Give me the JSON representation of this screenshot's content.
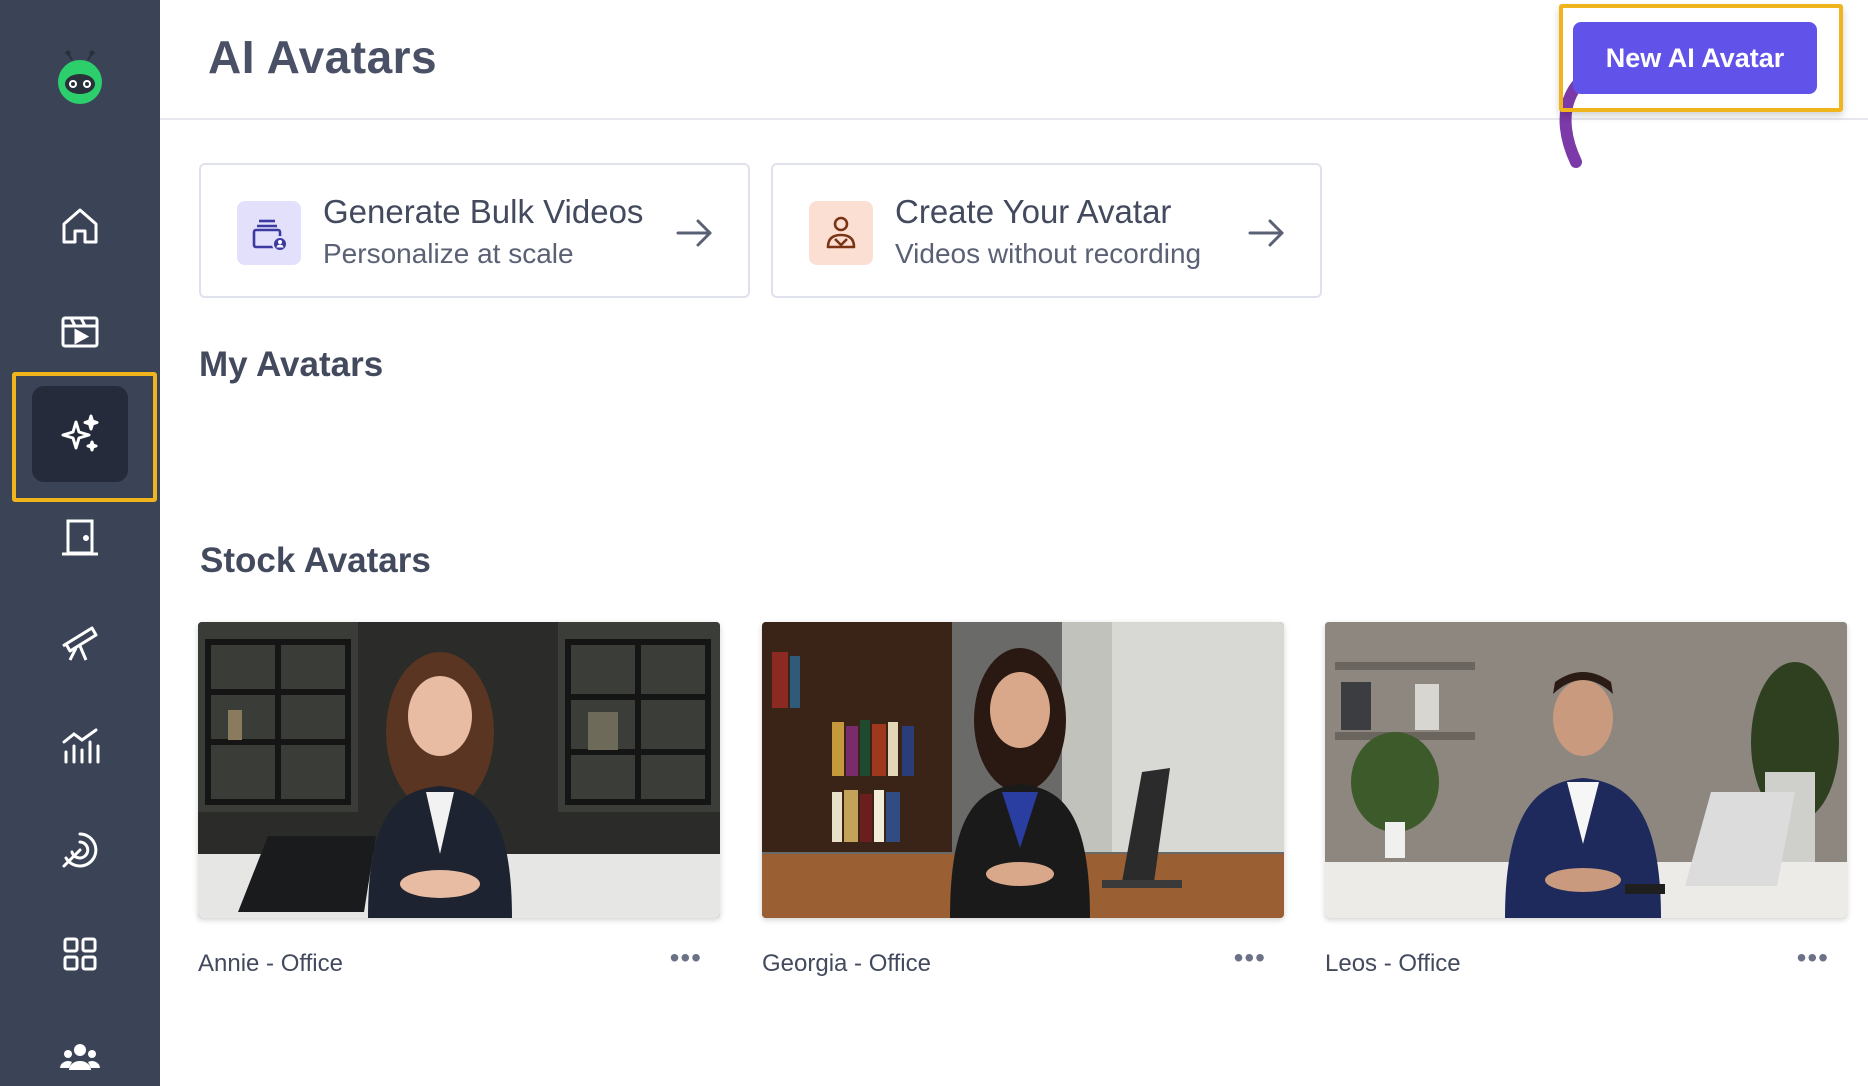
{
  "page": {
    "title": "AI Avatars"
  },
  "header": {
    "new_avatar_label": "New AI Avatar"
  },
  "sidebar": {
    "items": [
      {
        "icon": "home-icon"
      },
      {
        "icon": "video-clapper-icon"
      },
      {
        "icon": "sparkles-icon",
        "active": true
      },
      {
        "icon": "door-icon"
      },
      {
        "icon": "telescope-icon"
      },
      {
        "icon": "analytics-icon"
      },
      {
        "icon": "integrations-icon"
      },
      {
        "icon": "apps-grid-icon"
      },
      {
        "icon": "team-icon"
      }
    ]
  },
  "actions": [
    {
      "title": "Generate Bulk Videos",
      "subtitle": "Personalize at scale",
      "icon": "bulk-videos-icon"
    },
    {
      "title": "Create Your Avatar",
      "subtitle": "Videos without recording",
      "icon": "create-avatar-icon"
    }
  ],
  "sections": {
    "my_avatars": "My Avatars",
    "stock_avatars": "Stock Avatars"
  },
  "stock_avatars": [
    {
      "name": "Annie - Office",
      "more": "•••"
    },
    {
      "name": "Georgia - Office",
      "more": "•••"
    },
    {
      "name": "Leos - Office",
      "more": "•••"
    }
  ],
  "colors": {
    "sidebar": "#3b4356",
    "accent": "#6152ea",
    "highlight": "#f0b41c",
    "annotation_arrow": "#7b3aa8"
  }
}
